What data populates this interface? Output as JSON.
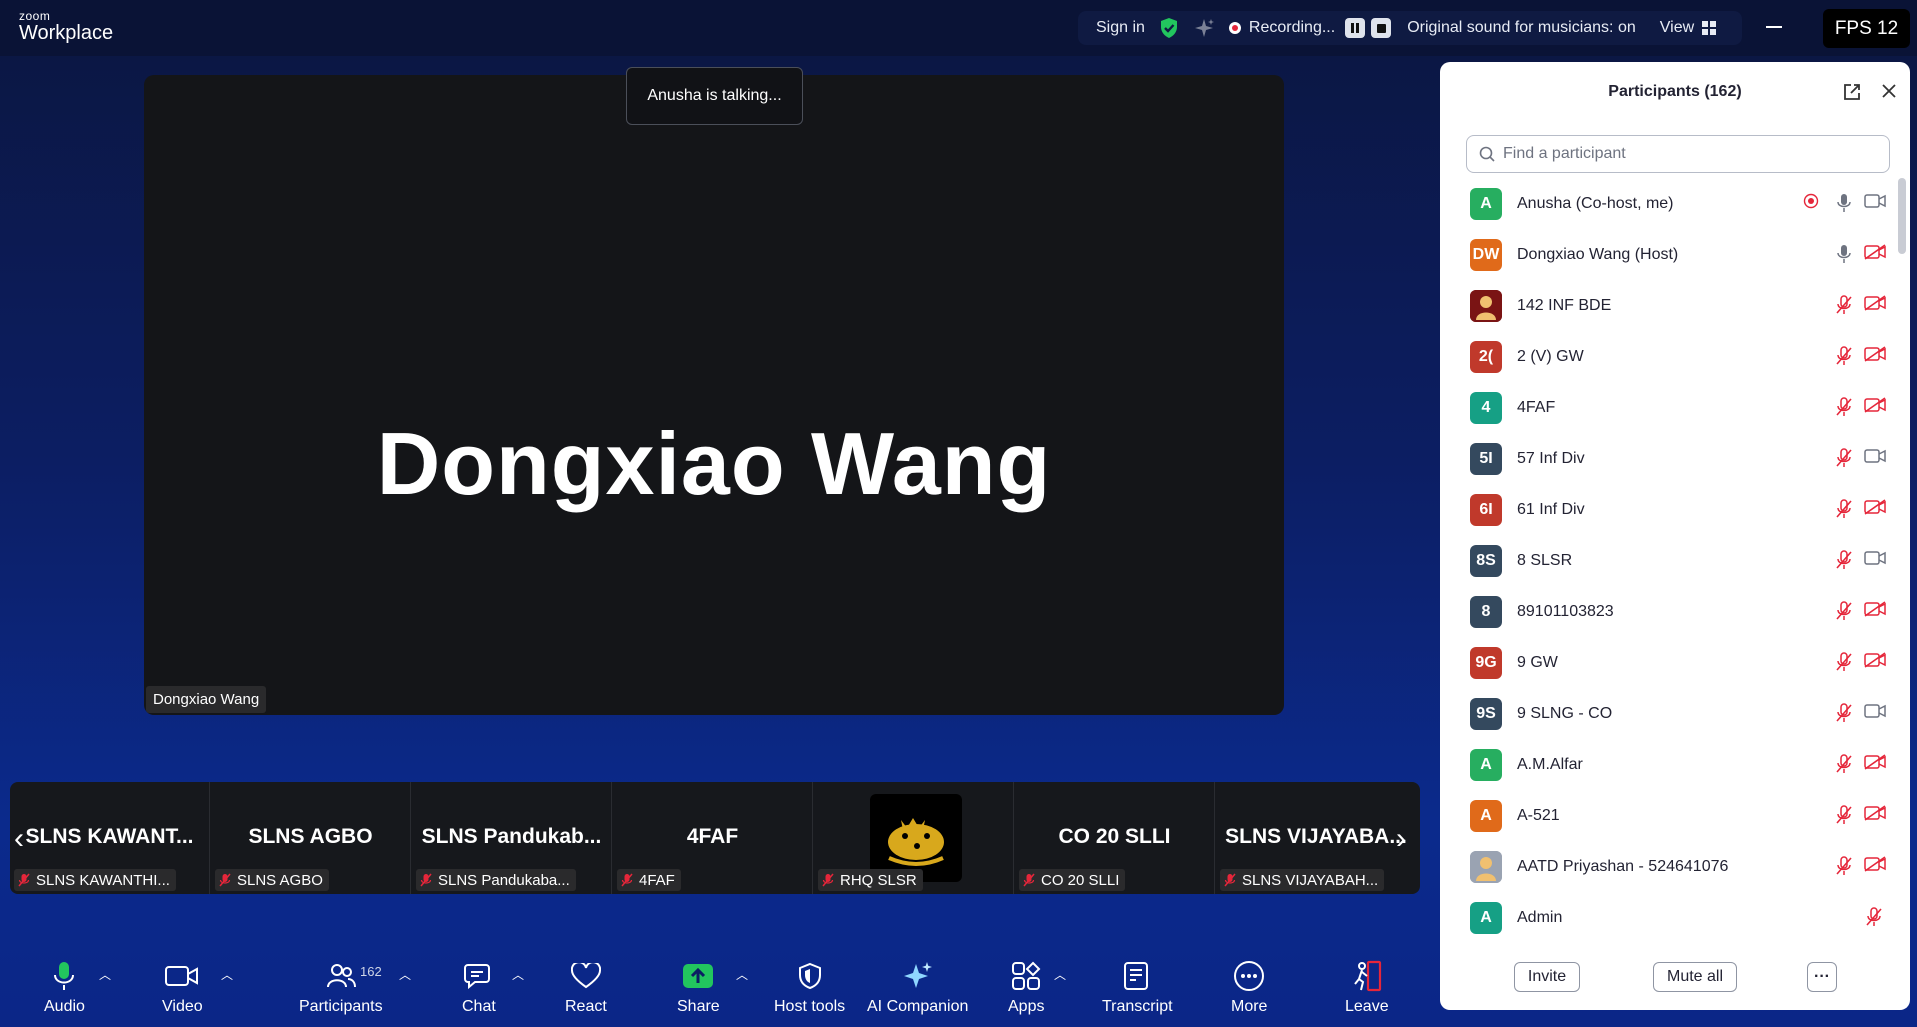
{
  "app": {
    "brand_small": "zoom",
    "brand_large": "Workplace"
  },
  "topbar": {
    "sign_in": "Sign in",
    "recording": "Recording...",
    "original_sound": "Original sound for musicians: on",
    "view": "View",
    "fps": "FPS 12"
  },
  "main": {
    "speaker_name": "Dongxiao Wang",
    "speaker_label": "Dongxiao Wang",
    "talking_toast": "Anusha is talking..."
  },
  "thumbnails": [
    {
      "title": "SLNS  KAWANT...",
      "label": "SLNS KAWANTHI..."
    },
    {
      "title": "SLNS AGBO",
      "label": "SLNS AGBO"
    },
    {
      "title": "SLNS Pandukab...",
      "label": "SLNS Pandukaba..."
    },
    {
      "title": "4FAF",
      "label": "4FAF"
    },
    {
      "title": "",
      "label": "RHQ SLSR"
    },
    {
      "title": "CO 20 SLLI",
      "label": "CO 20 SLLI"
    },
    {
      "title": "SLNS  VIJAYABA...",
      "label": "SLNS VIJAYABAH..."
    }
  ],
  "toolbar": {
    "audio": "Audio",
    "video": "Video",
    "participants": "Participants",
    "participants_count": "162",
    "chat": "Chat",
    "react": "React",
    "share": "Share",
    "host_tools": "Host tools",
    "ai_companion": "AI Companion",
    "apps": "Apps",
    "transcript": "Transcript",
    "more": "More",
    "leave": "Leave"
  },
  "panel": {
    "title": "Participants (162)",
    "search_placeholder": "Find a participant",
    "invite": "Invite",
    "mute_all": "Mute all",
    "more": "···",
    "participants": [
      {
        "initials": "A",
        "name": "Anusha (Co-host, me)",
        "color": "#27ae60",
        "mic": "on",
        "video": "on",
        "recording": true
      },
      {
        "initials": "DW",
        "name": "Dongxiao Wang (Host)",
        "color": "#e06a1a",
        "mic": "on",
        "video": "off"
      },
      {
        "initials": "",
        "name": "142 INF BDE",
        "color": "#7a1414",
        "mic": "muted",
        "video": "off",
        "image": true
      },
      {
        "initials": "2(",
        "name": "2 (V) GW",
        "color": "#c0392b",
        "mic": "muted",
        "video": "off"
      },
      {
        "initials": "4",
        "name": "4FAF",
        "color": "#16a085",
        "mic": "muted",
        "video": "off"
      },
      {
        "initials": "5I",
        "name": "57 Inf Div",
        "color": "#34495e",
        "mic": "muted",
        "video": "on"
      },
      {
        "initials": "6I",
        "name": "61 Inf Div",
        "color": "#c0392b",
        "mic": "muted",
        "video": "off"
      },
      {
        "initials": "8S",
        "name": "8 SLSR",
        "color": "#34495e",
        "mic": "muted",
        "video": "on"
      },
      {
        "initials": "8",
        "name": "89101103823",
        "color": "#34495e",
        "mic": "muted",
        "video": "off"
      },
      {
        "initials": "9G",
        "name": "9 GW",
        "color": "#c0392b",
        "mic": "muted",
        "video": "off"
      },
      {
        "initials": "9S",
        "name": "9 SLNG - CO",
        "color": "#34495e",
        "mic": "muted",
        "video": "on"
      },
      {
        "initials": "A",
        "name": "A.M.Alfar",
        "color": "#27ae60",
        "mic": "muted",
        "video": "off"
      },
      {
        "initials": "A",
        "name": "A-521",
        "color": "#e06a1a",
        "mic": "muted",
        "video": "off"
      },
      {
        "initials": "",
        "name": "AATD Priyashan - 524641076",
        "color": "#9aa3b2",
        "mic": "muted",
        "video": "off",
        "image": true
      },
      {
        "initials": "A",
        "name": "Admin",
        "color": "#16a085",
        "mic": "muted",
        "video": "none"
      }
    ]
  }
}
